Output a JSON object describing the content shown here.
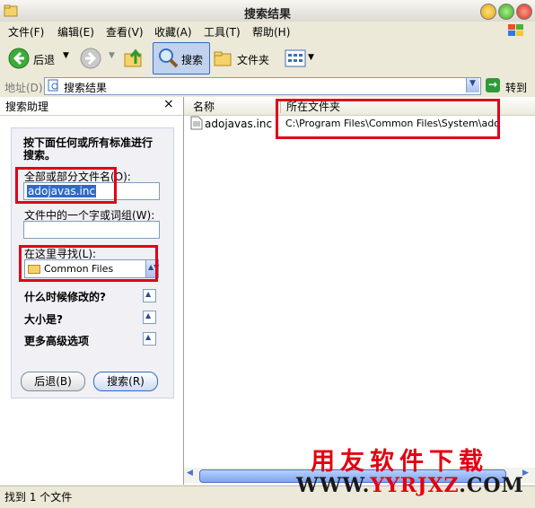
{
  "title": "搜索结果",
  "menu": [
    "文件(F)",
    "编辑(E)",
    "查看(V)",
    "收藏(A)",
    "工具(T)",
    "帮助(H)"
  ],
  "toolbar": {
    "back": "后退",
    "search": "搜索",
    "folders": "文件夹"
  },
  "address": {
    "label": "地址(D)",
    "value": "搜索结果",
    "go": "转到"
  },
  "search_pane": {
    "title": "搜索助理",
    "close": "×",
    "heading": "按下面任何或所有标准进行搜索。",
    "filename_label": "全部或部分文件名(O):",
    "filename_value": "adojavas.inc",
    "phrase_label": "文件中的一个字或词组(W):",
    "phrase_value": "",
    "lookin_label": "在这里寻找(L):",
    "lookin_value": "Common Files",
    "options": [
      "什么时候修改的?",
      "大小是?",
      "更多高级选项"
    ],
    "back_button": "后退(B)",
    "search_button": "搜索(R)"
  },
  "results": {
    "columns": [
      "名称",
      "所在文件夹"
    ],
    "rows": [
      {
        "name": "adojavas.inc",
        "folder": "C:\\Program Files\\Common Files\\System\\ado"
      }
    ]
  },
  "status": "找到 1 个文件",
  "watermark": {
    "line1": "用友软件下载",
    "line2_pre": "WWW.",
    "line2_hl": "YYRJXZ",
    "line2_post": ".COM"
  },
  "colors": {
    "highlight_box": "#e0001a",
    "accent": "#316ac5"
  }
}
